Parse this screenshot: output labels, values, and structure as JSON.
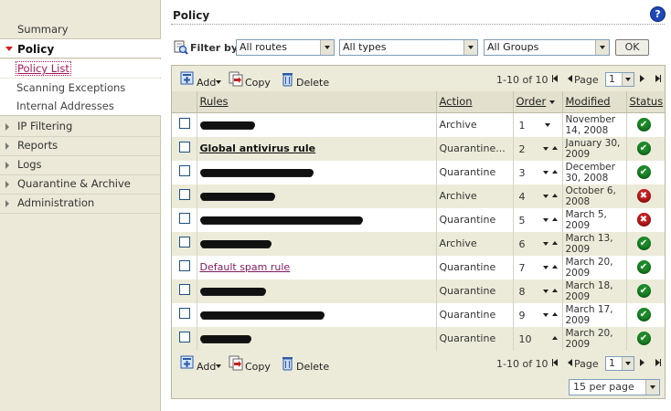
{
  "sidebar": {
    "items": [
      {
        "label": "Summary"
      },
      {
        "label": "Policy"
      },
      {
        "label": "IP Filtering"
      },
      {
        "label": "Reports"
      },
      {
        "label": "Logs"
      },
      {
        "label": "Quarantine & Archive"
      },
      {
        "label": "Administration"
      }
    ],
    "policy_subitems": [
      {
        "label": "Policy List"
      },
      {
        "label": "Scanning Exceptions"
      },
      {
        "label": "Internal Addresses"
      }
    ]
  },
  "header": {
    "title": "Policy",
    "help_symbol": "?"
  },
  "filter": {
    "label": "Filter by:",
    "routes": "All routes",
    "types": "All types",
    "groups": "All Groups",
    "ok_label": "OK"
  },
  "toolbar": {
    "add_label": "Add",
    "copy_label": "Copy",
    "delete_label": "Delete",
    "range": "1-10 of 10",
    "page_label": "Page",
    "page_value": "1"
  },
  "table": {
    "headers": {
      "rules": "Rules",
      "action": "Action",
      "order": "Order",
      "modified": "Modified",
      "status": "Status"
    },
    "rows": [
      {
        "name": "",
        "action": "Archive",
        "order": "1",
        "modified": "November 14, 2008",
        "status": "enabled"
      },
      {
        "name": "Global antivirus rule",
        "action": "Quarantine...",
        "order": "2",
        "modified": "January 30, 2009",
        "status": "enabled"
      },
      {
        "name": "",
        "action": "Quarantine",
        "order": "3",
        "modified": "December 30, 2008",
        "status": "enabled"
      },
      {
        "name": "",
        "action": "Archive",
        "order": "4",
        "modified": "October 6, 2008",
        "status": "disabled"
      },
      {
        "name": "",
        "action": "Quarantine",
        "order": "5",
        "modified": "March 5, 2009",
        "status": "disabled"
      },
      {
        "name": "",
        "action": "Archive",
        "order": "6",
        "modified": "March 13, 2009",
        "status": "enabled"
      },
      {
        "name": "Default spam rule",
        "action": "Quarantine",
        "order": "7",
        "modified": "March 20, 2009",
        "status": "enabled"
      },
      {
        "name": "",
        "action": "Quarantine",
        "order": "8",
        "modified": "March 18, 2009",
        "status": "enabled"
      },
      {
        "name": "",
        "action": "Quarantine",
        "order": "9",
        "modified": "March 17, 2009",
        "status": "enabled"
      },
      {
        "name": "",
        "action": "Quarantine",
        "order": "10",
        "modified": "March 20, 2009",
        "status": "enabled"
      }
    ]
  },
  "per_page": "15 per page",
  "colors": {
    "accent": "#d71c1c",
    "link": "#7e1a5b",
    "ok": "#1d8a28",
    "error": "#c41f1f",
    "panel": "#ecebd9"
  }
}
